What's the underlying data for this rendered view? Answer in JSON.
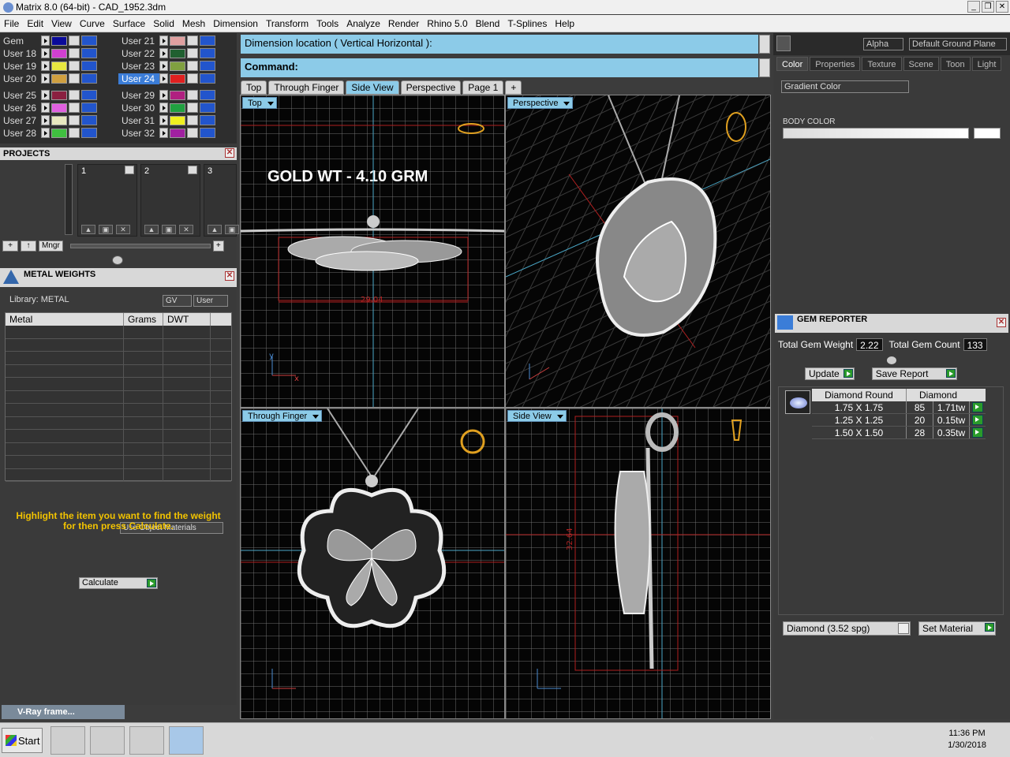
{
  "window": {
    "title": "Matrix 8.0 (64-bit) - CAD_1952.3dm"
  },
  "menu": [
    "File",
    "Edit",
    "View",
    "Curve",
    "Surface",
    "Solid",
    "Mesh",
    "Dimension",
    "Transform",
    "Tools",
    "Analyze",
    "Render",
    "Rhino 5.0",
    "Blend",
    "T-Splines",
    "Help"
  ],
  "layers": {
    "left": [
      {
        "name": "Gem",
        "color": "#0a0a9a"
      },
      {
        "name": "User 18",
        "color": "#d040d0"
      },
      {
        "name": "User 19",
        "color": "#e8e840"
      },
      {
        "name": "User 20",
        "color": "#d0a040"
      },
      {
        "name": "User 25",
        "color": "#8a2040"
      },
      {
        "name": "User 26",
        "color": "#e060e0"
      },
      {
        "name": "User 27",
        "color": "#e8e8c0"
      },
      {
        "name": "User 28",
        "color": "#40c040"
      }
    ],
    "right": [
      {
        "name": "User 21",
        "color": "#e0a0a0"
      },
      {
        "name": "User 22",
        "color": "#206030"
      },
      {
        "name": "User 23",
        "color": "#80a040"
      },
      {
        "name": "User 24",
        "color": "#e02020",
        "selected": true
      },
      {
        "name": "User 29",
        "color": "#b02080"
      },
      {
        "name": "User 30",
        "color": "#20a040"
      },
      {
        "name": "User 31",
        "color": "#f0f020"
      },
      {
        "name": "User 32",
        "color": "#a020a0"
      }
    ]
  },
  "projects": {
    "title": "PROJECTS",
    "cards": [
      "1",
      "2",
      "3"
    ],
    "manager_label": "Mngr"
  },
  "metal_weights": {
    "title": "METAL WEIGHTS",
    "library_label": "Library: METAL",
    "gv_label": "GV",
    "user_label": "User",
    "columns": [
      "Metal",
      "Grams",
      "DWT"
    ],
    "use_object_materials": "Use Object Materials",
    "hint": "Highlight the item you want to find the weight for then press Calculate.",
    "calculate_label": "Calculate"
  },
  "vray_label": "V-Ray frame...",
  "command": {
    "prompt": "Dimension location ( Vertical  Horizontal ):",
    "command_label": "Command:"
  },
  "viewport_tabs": [
    "Top",
    "Through Finger",
    "Side View",
    "Perspective",
    "Page 1",
    "+"
  ],
  "active_tab": "Side View",
  "viewports": {
    "top": {
      "label": "Top",
      "annotation": "GOLD WT - 4.10 GRM",
      "dimension": "29.04"
    },
    "perspective": {
      "label": "Perspective"
    },
    "through_finger": {
      "label": "Through Finger"
    },
    "side_view": {
      "label": "Side View",
      "dimension": "32.64"
    }
  },
  "right_panel": {
    "alpha_label": "Alpha",
    "ground_plane_label": "Default Ground Plane",
    "tabs": [
      "Color",
      "Properties",
      "Texture",
      "Scene",
      "Toon",
      "Light"
    ],
    "active_tab": "Color",
    "gradient_label": "Gradient Color",
    "body_color_label": "BODY COLOR"
  },
  "gem_reporter": {
    "title": "GEM REPORTER",
    "total_weight_label": "Total Gem Weight",
    "total_weight": "2.22",
    "total_count_label": "Total Gem Count",
    "total_count": "133",
    "update_label": "Update",
    "save_report_label": "Save Report",
    "columns": [
      "Diamond Round",
      "Diamond"
    ],
    "rows": [
      {
        "size": "1.75 X 1.75",
        "count": "85",
        "weight": "1.71tw"
      },
      {
        "size": "1.25 X 1.25",
        "count": "20",
        "weight": "0.15tw"
      },
      {
        "size": "1.50 X 1.50",
        "count": "28",
        "weight": "0.35tw"
      }
    ],
    "material": "Diamond   (3.52 spg)",
    "set_material_label": "Set Material"
  },
  "taskbar": {
    "start_label": "Start",
    "time": "11:36 PM",
    "date": "1/30/2018"
  }
}
